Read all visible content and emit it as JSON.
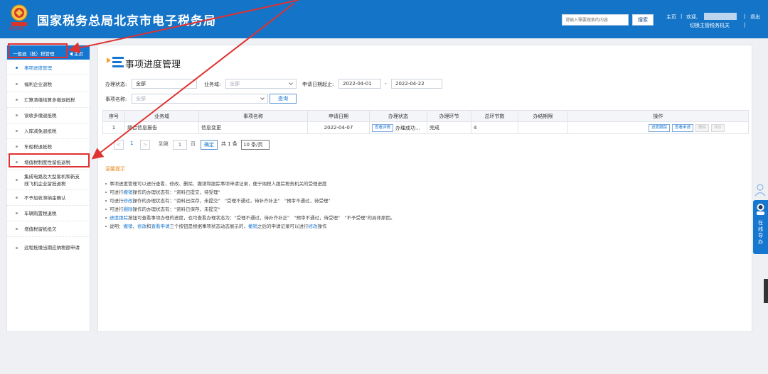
{
  "header": {
    "site_title": "国家税务总局北京市电子税务局",
    "emblem_caption": "税务总局",
    "search_placeholder": "请输入需要搜索的内容",
    "search_button": "搜索",
    "home_link": "主页",
    "welcome_text": "欢迎,",
    "logout_link": "退出",
    "switch_label": "切换主管税务机关"
  },
  "sidebar": {
    "header_label": "一般退（抵）税管理",
    "home_label": "主页",
    "items": [
      {
        "label": "事项进度管理",
        "active": true
      },
      {
        "label": "福利企业退税"
      },
      {
        "label": "汇算清缴结算多缴退抵税"
      },
      {
        "label": "误收多缴退抵税"
      },
      {
        "label": "入库减免退抵税"
      },
      {
        "label": "车船税退抵税"
      },
      {
        "label": "增值税制度性留抵退税",
        "highlighted": true
      },
      {
        "label": "集成电路及大型客机和新支线飞机企业留抵退税"
      },
      {
        "label": "不予加收滞纳金确认"
      },
      {
        "label": "车辆购置税退税"
      },
      {
        "label": "增值税留抵抵欠"
      },
      {
        "label": "远程抵缴当期应纳税额申请"
      }
    ]
  },
  "main": {
    "title": "事项进度管理",
    "filters": {
      "status_label": "办理状态:",
      "status_value": "全部",
      "domain_label": "业务域:",
      "domain_value": "全部",
      "date_label": "申请日期起止:",
      "date_start": "2022-04-01",
      "date_sep": "-",
      "date_end": "2022-04-22",
      "item_label": "事项名称:",
      "item_value": "全部",
      "query_button": "查询"
    },
    "table": {
      "headers": [
        "序号",
        "业务域",
        "事项名称",
        "申请日期",
        "办理状态",
        "办理环节",
        "总环节数",
        "办结期限",
        "操作"
      ],
      "rows": [
        {
          "index": "1",
          "domain": "综合信息报告",
          "item": "信息变更",
          "date": "2022-04-07",
          "detail_btn": "查看详情",
          "status": "办理成功...",
          "stage": "完成",
          "total": "4",
          "deadline": "",
          "actions": [
            "进度跟踪",
            "查看申请",
            "删除",
            "评价"
          ]
        }
      ]
    },
    "pagination": {
      "prev": "<",
      "current": "1",
      "next": ">",
      "goto_label": "到第",
      "goto_value": "1",
      "page_unit": "页",
      "confirm": "确定",
      "total": "共 1 条",
      "page_size": "10 条/页"
    },
    "tips": {
      "title": "温馨提示",
      "lines": [
        {
          "parts": [
            {
              "t": "事项进度管理可以进行查看、修改、删除、撤销和跟踪事项申请记录，便于纳税人跟踪税务机关的受理进度"
            }
          ]
        },
        {
          "parts": [
            {
              "t": "可进行"
            },
            {
              "t": "撤销",
              "kw": true
            },
            {
              "t": "操作的办理状态有：\"资料已提交，待受理\""
            }
          ]
        },
        {
          "parts": [
            {
              "t": "可进行"
            },
            {
              "t": "修改",
              "kw": true
            },
            {
              "t": "操作的办理状态有：\"资料已保存，未提交\"　\"受理不通过，待补齐补正\"　\"预审不通过，待受理\""
            }
          ]
        },
        {
          "parts": [
            {
              "t": "可进行"
            },
            {
              "t": "删除",
              "kw": true
            },
            {
              "t": "操作的办理状态有：\"资料已保存，未提交\""
            }
          ]
        },
        {
          "parts": [
            {
              "t": "进度跟踪",
              "kw": true
            },
            {
              "t": "按钮可查看事项办理的进度，也可查看办理状态为：\"受理不通过，待补齐补正\"　\"预审不通过，待受理\"　\"不予受理\"的具体原因。"
            }
          ]
        },
        {
          "parts": [
            {
              "t": "说明："
            },
            {
              "t": "撤销",
              "kw": true
            },
            {
              "t": "、"
            },
            {
              "t": "修改",
              "kw": true
            },
            {
              "t": "和"
            },
            {
              "t": "查看申请",
              "kw": true
            },
            {
              "t": "三个按钮是根据事项状态动态展示的，"
            },
            {
              "t": "撤销",
              "kw": true
            },
            {
              "t": "之后的申请记录可以进行"
            },
            {
              "t": "修改",
              "kw": true
            },
            {
              "t": "操作"
            }
          ]
        }
      ]
    }
  },
  "float_widget": {
    "label_chars": [
      "在",
      "线",
      "导",
      "办"
    ]
  },
  "colors": {
    "header_blue": "#1474c8",
    "accent_blue": "#1677d1",
    "annotation_red": "#e03232",
    "tip_orange": "#e8891c"
  }
}
